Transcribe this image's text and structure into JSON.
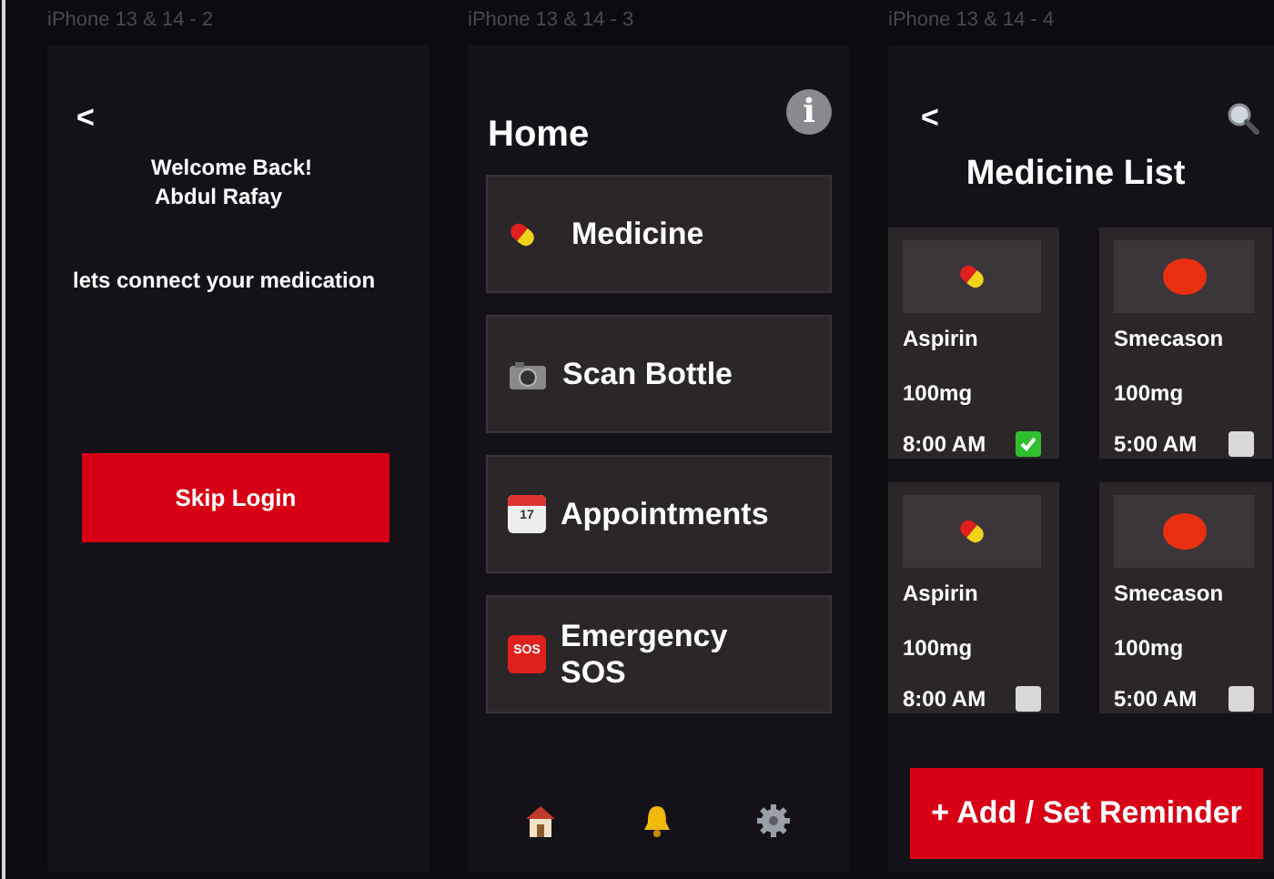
{
  "login_screen": {
    "frame_label": "iPhone 13 & 14 - 2",
    "back": "<",
    "welcome": "Welcome Back!",
    "user_name": "Abdul Rafay",
    "subtitle": "lets connect your medication",
    "button": "Skip Login"
  },
  "home_screen": {
    "frame_label": "iPhone 13 & 14 - 3",
    "info": "i",
    "title": "Home",
    "menu": [
      {
        "label": "Medicine"
      },
      {
        "label": "Scan Bottle"
      },
      {
        "label": "Appointments",
        "icon_text": "17"
      },
      {
        "label": "Emergency SOS",
        "icon_text": "SOS"
      }
    ]
  },
  "medicine_list_screen": {
    "frame_label": "iPhone 13 & 14 - 4",
    "back": "<",
    "title": "Medicine List",
    "medicines": [
      {
        "kind": "capsule",
        "name": "Aspirin",
        "dose": "100mg",
        "time": "8:00 AM",
        "checked": true
      },
      {
        "kind": "tablet",
        "name": "Smecason",
        "dose": "100mg",
        "time": "5:00 AM",
        "checked": false
      },
      {
        "kind": "capsule",
        "name": "Aspirin",
        "dose": "100mg",
        "time": "8:00 AM",
        "checked": false
      },
      {
        "kind": "tablet",
        "name": "Smecason",
        "dose": "100mg",
        "time": "5:00 AM",
        "checked": false
      }
    ],
    "button": "+ Add / Set Reminder"
  }
}
